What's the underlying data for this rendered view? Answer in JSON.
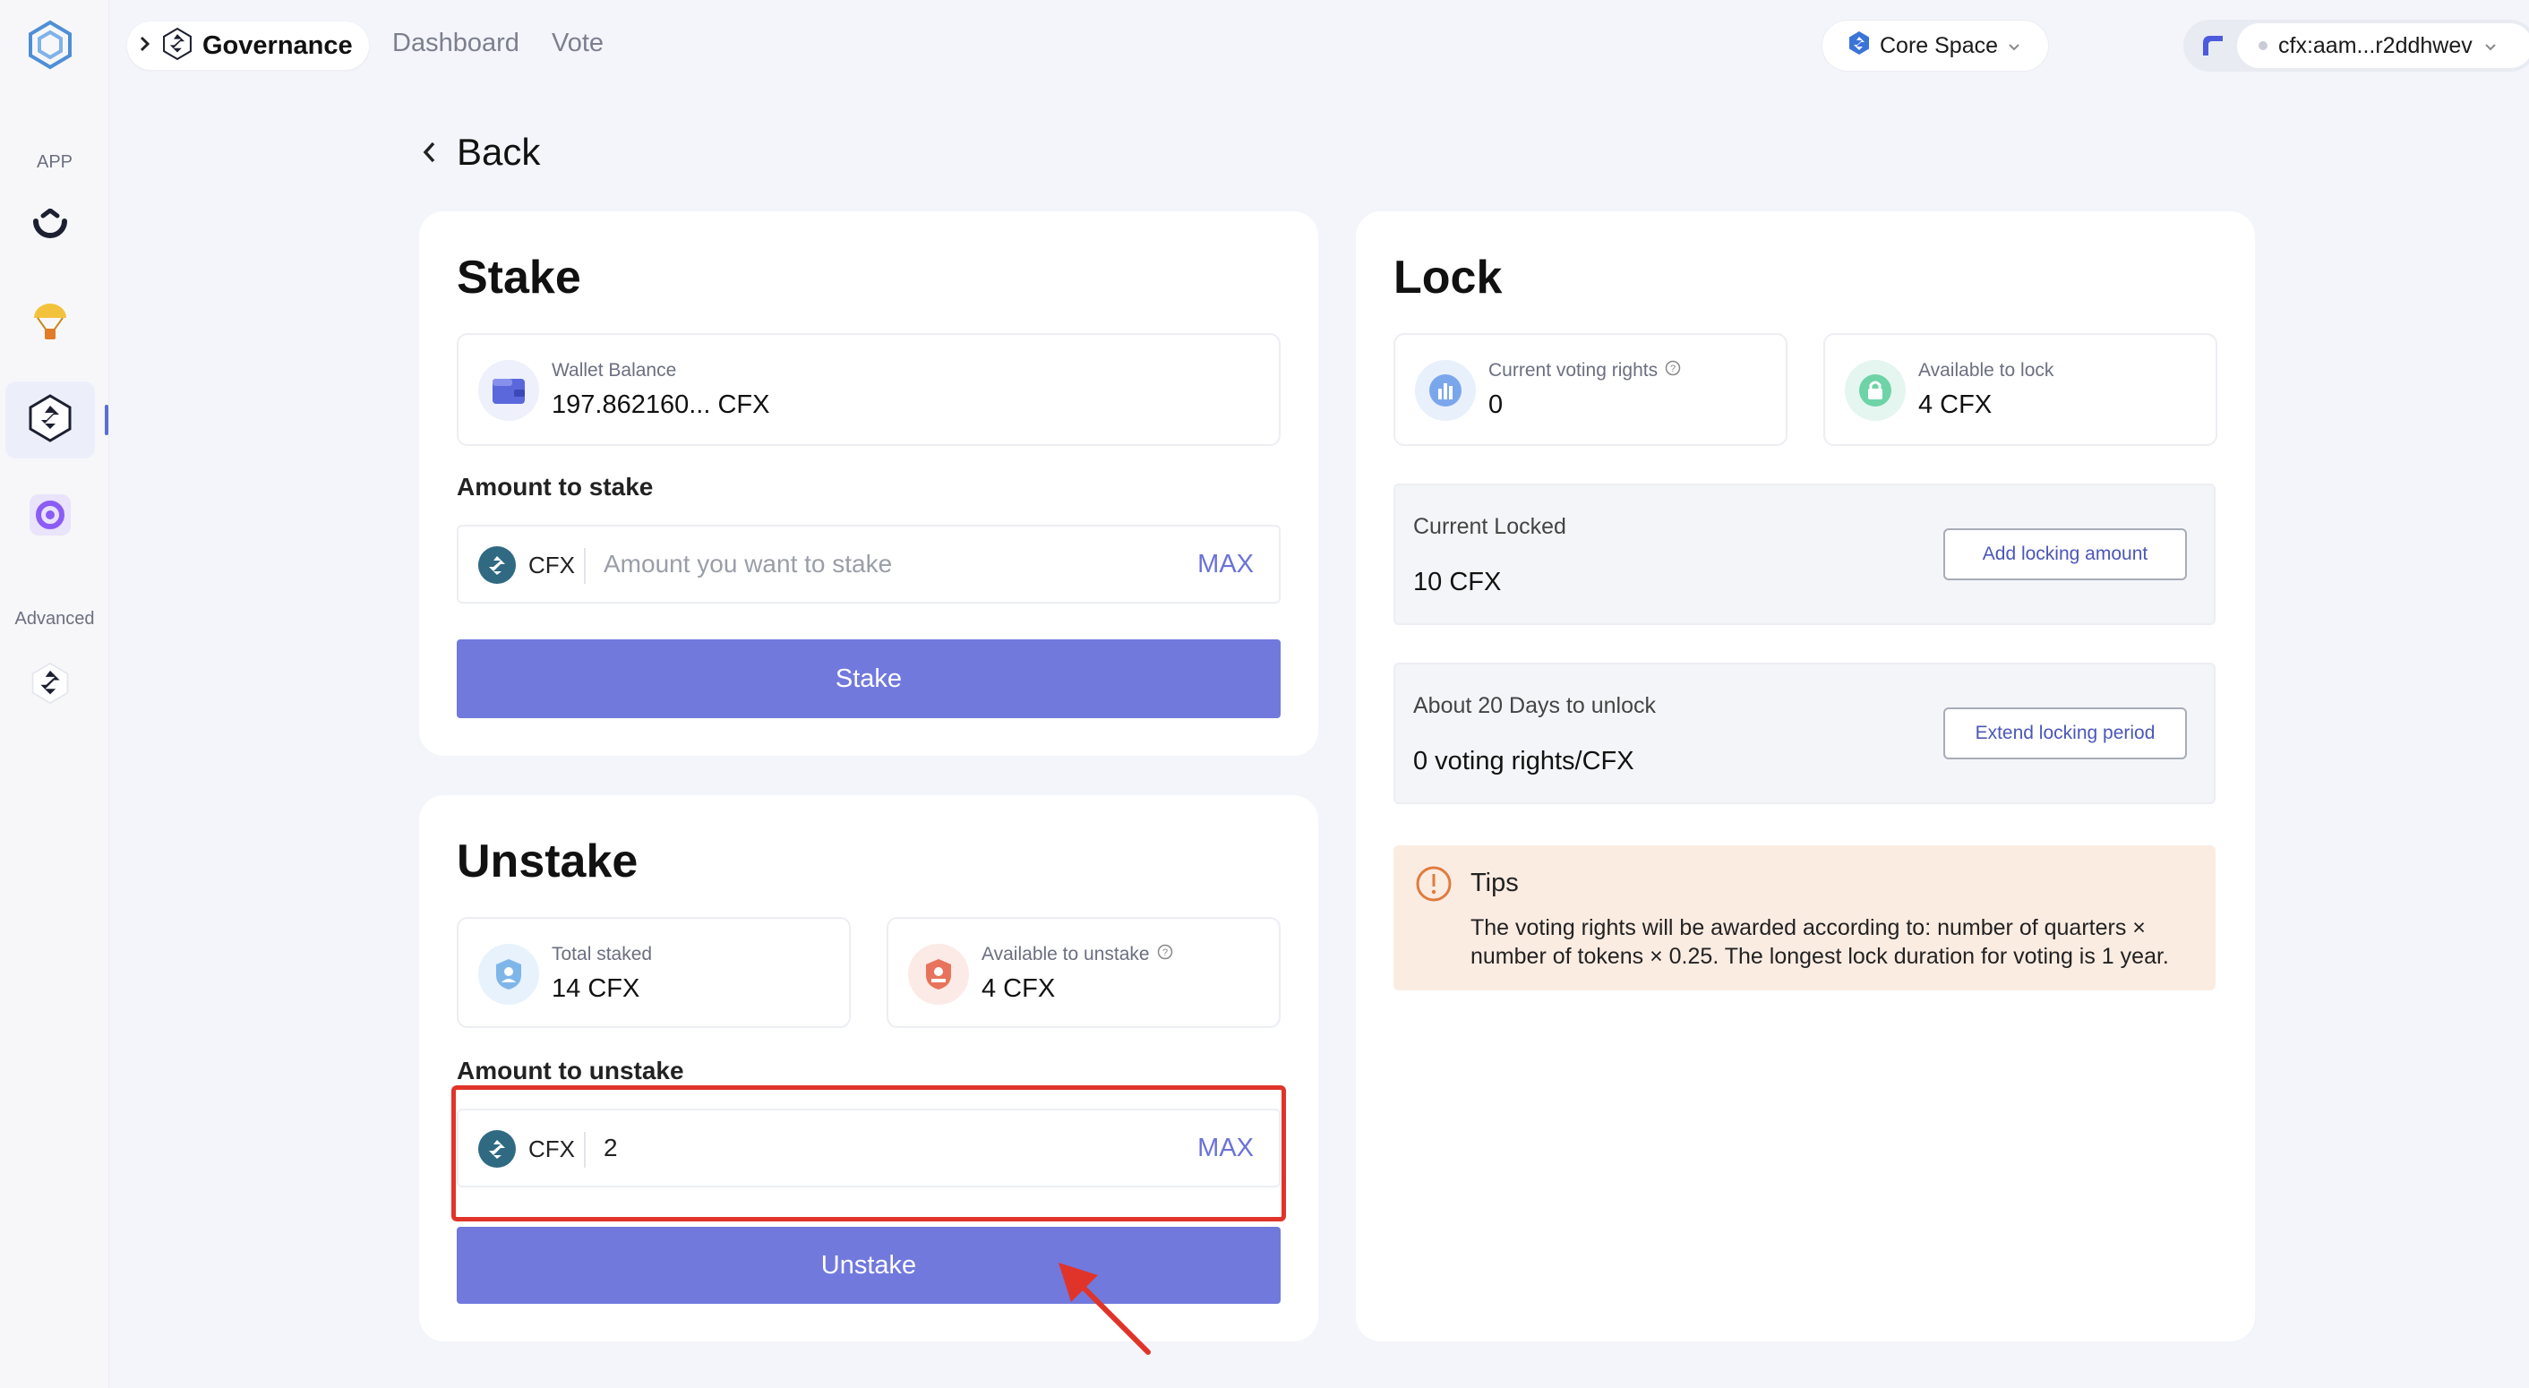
{
  "sidebar": {
    "section_app": "APP",
    "section_advanced": "Advanced",
    "items": [
      {
        "icon": "omnibridge-icon"
      },
      {
        "icon": "airdrop-parachute-icon"
      },
      {
        "icon": "governance-icon",
        "active": true
      },
      {
        "icon": "purple-app-icon"
      },
      {
        "icon": "conflux-advanced-icon"
      }
    ]
  },
  "header": {
    "title": "Governance",
    "nav": [
      "Dashboard",
      "Vote"
    ],
    "network": "Core Space",
    "account": "cfx:aam...r2ddhwev"
  },
  "back_label": "Back",
  "stake": {
    "title": "Stake",
    "wallet_balance_label": "Wallet Balance",
    "wallet_balance_value": "197.862160... CFX",
    "amount_label": "Amount to stake",
    "token": "CFX",
    "placeholder": "Amount you want to stake",
    "max_label": "MAX",
    "button": "Stake"
  },
  "unstake": {
    "title": "Unstake",
    "total_staked_label": "Total staked",
    "total_staked_value": "14 CFX",
    "available_label": "Available to unstake",
    "available_value": "4 CFX",
    "amount_label": "Amount to unstake",
    "token": "CFX",
    "amount_value": "2",
    "max_label": "MAX",
    "button": "Unstake"
  },
  "lock": {
    "title": "Lock",
    "voting_rights_label": "Current voting rights",
    "voting_rights_value": "0",
    "available_label": "Available to lock",
    "available_value": "4 CFX",
    "current_locked_label": "Current Locked",
    "current_locked_value": "10 CFX",
    "add_button": "Add locking amount",
    "unlock_label": "About 20 Days to unlock",
    "unlock_value": "0 voting rights/CFX",
    "extend_button": "Extend locking period",
    "tips_title": "Tips",
    "tips_text": "The voting rights will be awarded according to: number of quarters × number of tokens × 0.25. The longest lock duration for voting is 1 year."
  },
  "colors": {
    "primary": "#7179dd",
    "max_text": "#6b72d6",
    "tips_bg": "#fbece2",
    "highlight": "#e0342a"
  }
}
